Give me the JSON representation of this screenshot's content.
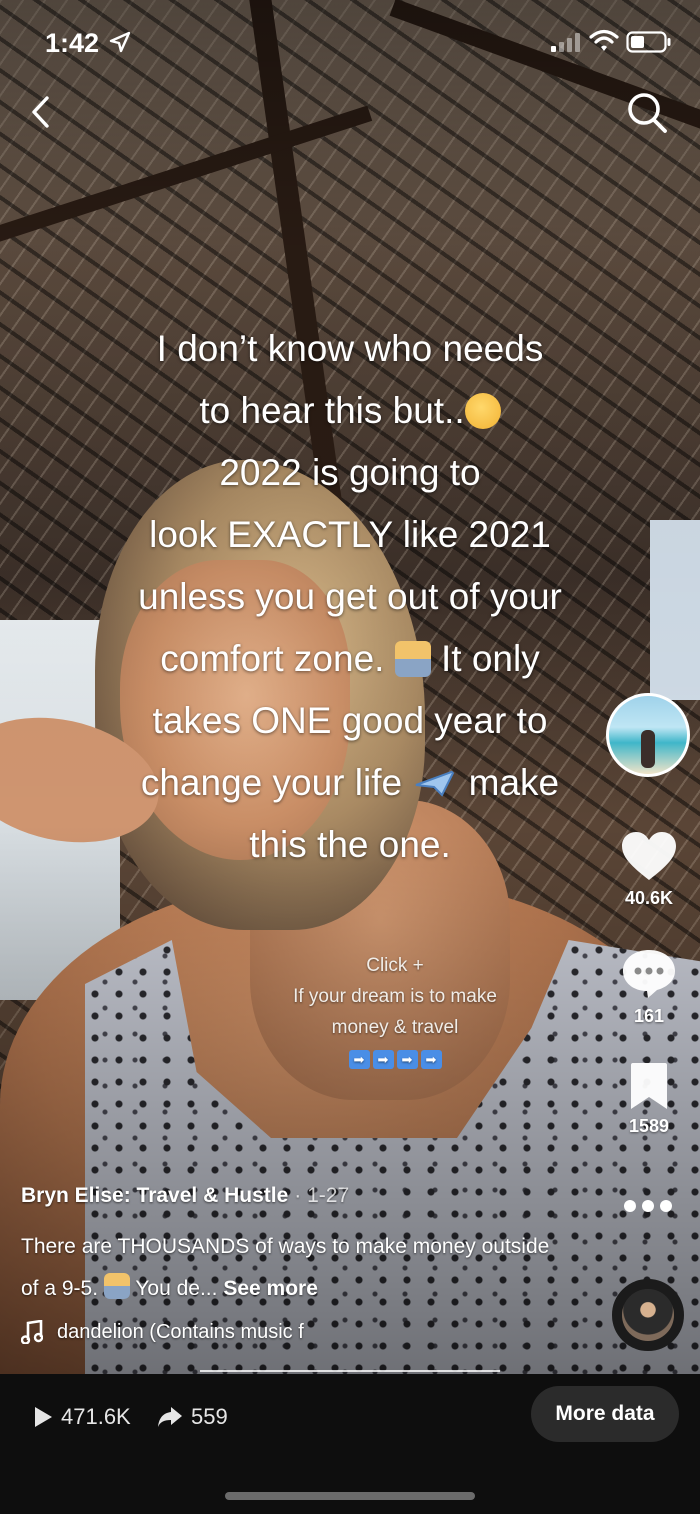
{
  "status_bar": {
    "time": "1:42",
    "icons": [
      "location-arrow-icon",
      "cellular-signal-icon",
      "wifi-icon",
      "battery-icon"
    ]
  },
  "nav": {
    "back_icon": "chevron-left-icon",
    "search_icon": "search-icon"
  },
  "overlay": {
    "lines": [
      "I don’t know who needs",
      "to hear this but..",
      "2022 is going to",
      "look EXACTLY like 2021",
      "unless you get out of your",
      "comfort zone.",
      "It only",
      "takes ONE good year to",
      "change your life",
      "make",
      "this the one."
    ]
  },
  "sticker": {
    "line1": "Click +",
    "line2": "If your dream is to make",
    "line3": "money & travel",
    "arrows": [
      "➡",
      "➡",
      "➡",
      "➡"
    ]
  },
  "rail": {
    "likes": "40.6K",
    "comments": "161",
    "saves": "1589"
  },
  "post": {
    "author": "Bryn Elise: Travel & Hustle",
    "date": "· 1-27",
    "description": "There are THOUSANDS of ways to make money outside of a 9-5. ",
    "description_tail": " You de...",
    "see_more": "See more",
    "music": "dandelion (Contains music f"
  },
  "bottom_bar": {
    "views": "471.6K",
    "shares": "559",
    "more_data": "More data"
  },
  "colors": {
    "bottom_bar": "#0e0e0e",
    "button_bg": "#2b2b2b",
    "text": "#ffffff"
  }
}
